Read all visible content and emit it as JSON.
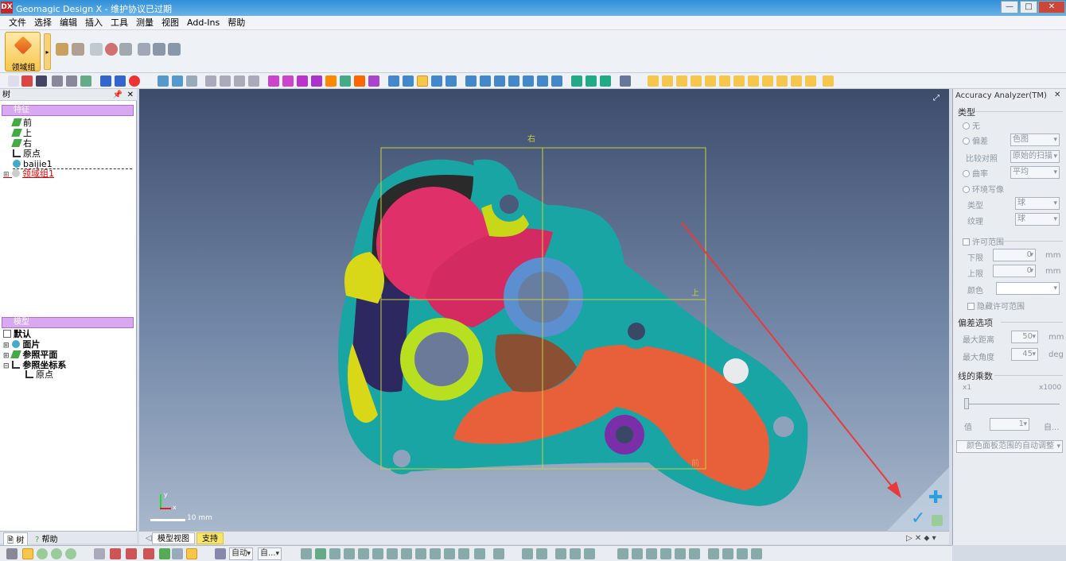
{
  "window": {
    "title": "Geomagic Design X - 维护协议已过期",
    "icon_text": "DX",
    "minimize": "—",
    "maximize": "□",
    "close": "✕"
  },
  "menu": [
    "文件",
    "选择",
    "编辑",
    "插入",
    "工具",
    "测量",
    "视图",
    "Add-Ins",
    "帮助"
  ],
  "ribbon": {
    "group_button_label": "领域组"
  },
  "tree_panel": {
    "header": "树",
    "features_section": "特征",
    "features": [
      "前",
      "上",
      "右",
      "原点",
      "baijie1",
      "领域组1"
    ],
    "model_section": "模型",
    "model_default": "默认",
    "model_items": [
      "面片",
      "参照平面",
      "参照坐标系",
      "原点"
    ],
    "tabs": [
      "树",
      "帮助"
    ]
  },
  "viewport": {
    "plane_labels": {
      "right": "右",
      "top": "上",
      "front": "前"
    },
    "scale_label": "10 mm",
    "axis_labels": {
      "y": "y",
      "x": "x"
    },
    "tabs": [
      "模型视图",
      "支持"
    ]
  },
  "accuracy_panel": {
    "title": "Accuracy Analyzer(TM)",
    "type_header": "类型",
    "options": {
      "none": "无",
      "deviation": "偏差",
      "compare": "比较对照",
      "curvature": "曲率",
      "environment": "环境写像",
      "type": "类型",
      "texture": "纹理"
    },
    "values": {
      "deviation": "色图",
      "compare": "原始的扫描",
      "curvature": "平均",
      "type": "球",
      "texture": "球"
    },
    "tolerance_header": "许可范围",
    "lower_label": "下限",
    "lower_value": "0",
    "upper_label": "上限",
    "upper_value": "0",
    "unit": "mm",
    "color_label": "颜色",
    "hide_label": "隐藏许可范围",
    "dev_options_header": "偏差选项",
    "max_dist_label": "最大距离",
    "max_dist_value": "50",
    "max_angle_label": "最大角度",
    "max_angle_value": "45",
    "angle_unit": "deg",
    "multiplier_header": "线的乘数",
    "slider_min": "x1",
    "slider_max": "x1000",
    "value_label": "值",
    "value_value": "1",
    "auto_label": "自...",
    "auto_adjust_button": "颜色面板范围的自动调整"
  },
  "statusbar": {
    "combo1": "自动",
    "combo2": "自..."
  },
  "colors": {
    "title_bar": "#2f8fd8",
    "section_header": "#d8a8f0",
    "mesh_teal": "#1aa5a5",
    "mesh_pink": "#e0306a",
    "mesh_yellow": "#d8d818",
    "mesh_orange": "#e8603a",
    "mesh_blue": "#5b8fd0",
    "mesh_purple": "#7a2ea8",
    "arrow_red": "#e83a3a"
  }
}
